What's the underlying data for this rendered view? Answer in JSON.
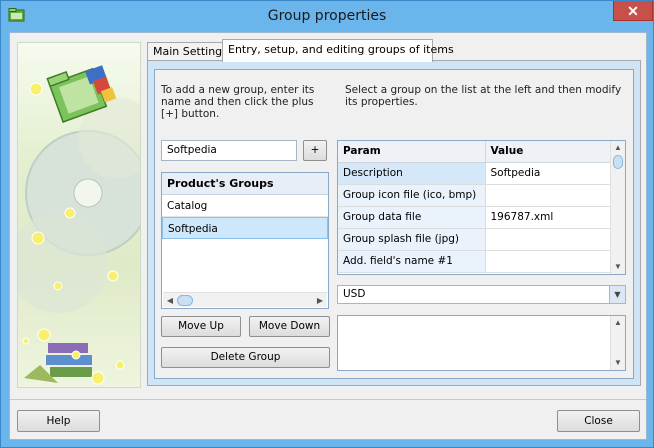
{
  "window": {
    "title": "Group properties",
    "close_glyph": "✕"
  },
  "tabs": [
    {
      "label": "Main Settings"
    },
    {
      "label": "Entry, setup, and editing groups of items"
    }
  ],
  "hints": {
    "left": "To add a new group, enter its name and then click the plus [+] button.",
    "right": "Select a group on the list at the left and then modify its properties."
  },
  "new_group": {
    "value": "Softpedia",
    "add_label": "+"
  },
  "groups_list": {
    "header": "Product's Groups",
    "items": [
      "Catalog",
      "Softpedia"
    ]
  },
  "buttons": {
    "move_up": "Move Up",
    "move_down": "Move Down",
    "delete_group": "Delete Group",
    "help": "Help",
    "close": "Close"
  },
  "param_grid": {
    "columns": [
      "Param",
      "Value"
    ],
    "rows": [
      {
        "param": "Description",
        "value": "Softpedia"
      },
      {
        "param": "Group icon file (ico, bmp)",
        "value": ""
      },
      {
        "param": "Group data file",
        "value": "196787.xml"
      },
      {
        "param": "Group splash file (jpg)",
        "value": ""
      },
      {
        "param": "Add. field's name #1",
        "value": ""
      }
    ]
  },
  "currency": {
    "selected": "USD"
  },
  "icons": {
    "app": "folder-app-icon",
    "sidebar": "decorative-folder-disc-illustration"
  }
}
